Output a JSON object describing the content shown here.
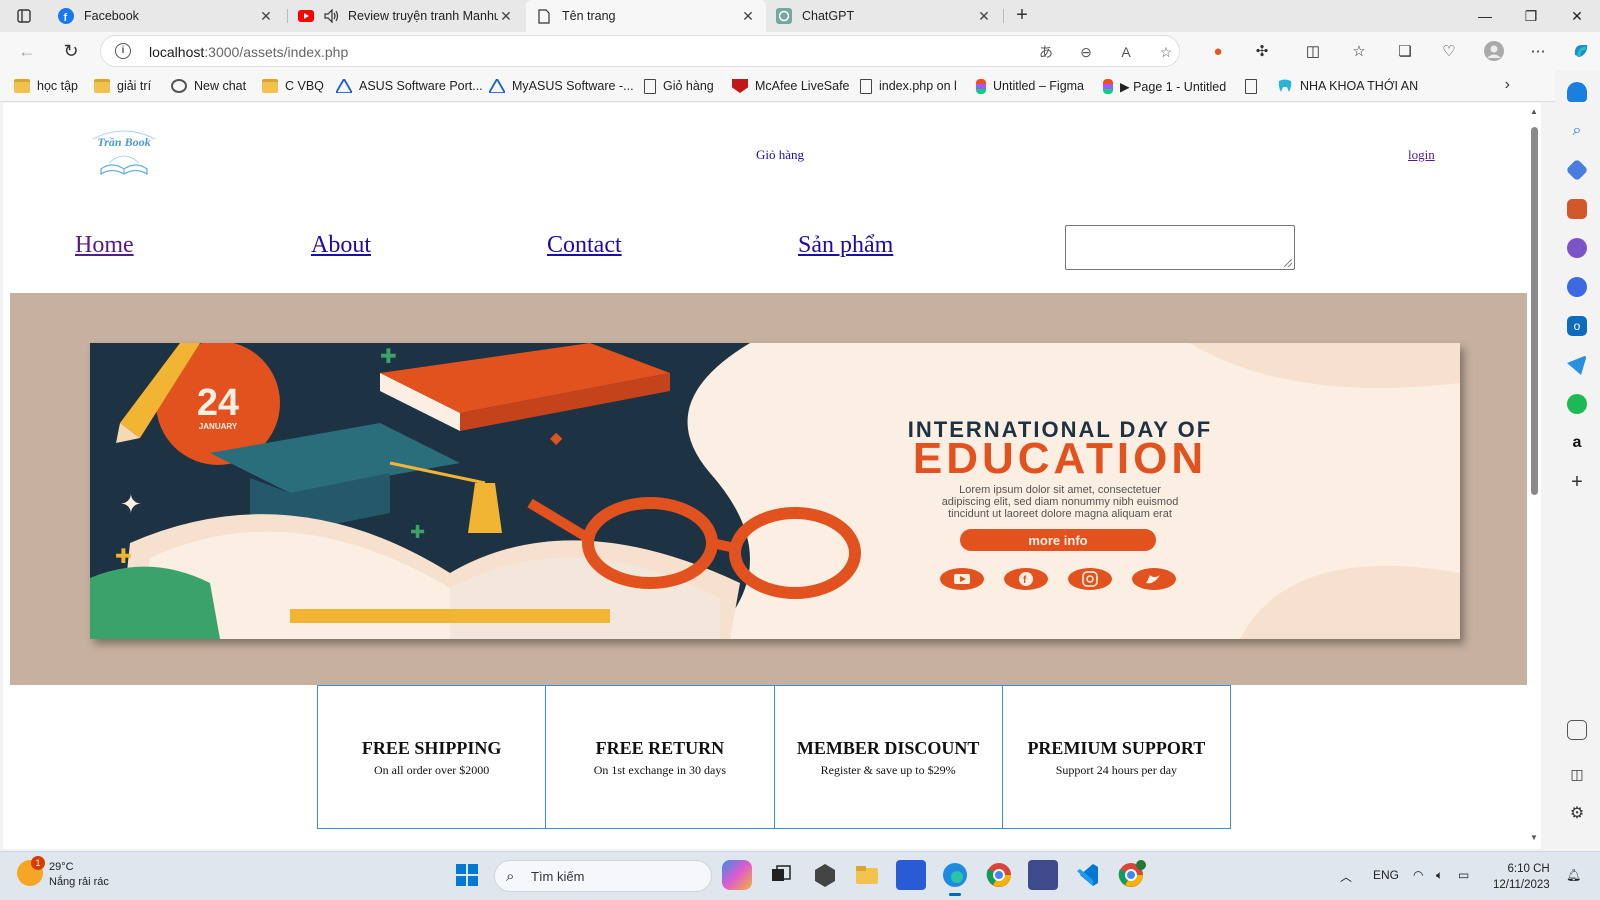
{
  "browser": {
    "tabs": [
      {
        "title": "Facebook",
        "icon": "facebook-icon",
        "active": false
      },
      {
        "title": "Review truyện tranh Manhua",
        "icon": "youtube-icon",
        "active": false
      },
      {
        "title": "Tên trang",
        "icon": "page-icon",
        "active": true
      },
      {
        "title": "ChatGPT",
        "icon": "chatgpt-icon",
        "active": false
      }
    ],
    "url_host": "localhost",
    "url_path": ":3000/assets/index.php",
    "bookmarks": [
      {
        "label": "học tập",
        "icon": "folder-icon"
      },
      {
        "label": "giải trí",
        "icon": "folder-icon"
      },
      {
        "label": "New chat",
        "icon": "chatgpt-icon"
      },
      {
        "label": "C VBQ",
        "icon": "folder-icon"
      },
      {
        "label": "ASUS Software Port...",
        "icon": "asus-icon"
      },
      {
        "label": "MyASUS Software -...",
        "icon": "asus-icon"
      },
      {
        "label": "Giỏ hàng",
        "icon": "page-icon"
      },
      {
        "label": "McAfee LiveSafe",
        "icon": "mcafee-icon"
      },
      {
        "label": "index.php on l",
        "icon": "page-icon"
      },
      {
        "label": "Untitled – Figma",
        "icon": "figma-icon"
      },
      {
        "label": "▶ Page 1 - Untitled",
        "icon": "figma-icon"
      },
      {
        "label": "",
        "icon": "page-icon"
      },
      {
        "label": "NHA KHOA THỚI AN",
        "icon": "tooth-icon"
      }
    ]
  },
  "page": {
    "logo_text": "Trần Book",
    "cart_link": "Giỏ hàng",
    "login_link": "login",
    "nav": [
      {
        "label": "Home",
        "visited": true
      },
      {
        "label": "About",
        "visited": false
      },
      {
        "label": "Contact",
        "visited": false
      },
      {
        "label": "Sản phẩm",
        "visited": false
      }
    ],
    "search_value": "",
    "banner": {
      "heading_line1": "INTERNATIONAL DAY OF",
      "heading_line2": "EDUCATION",
      "date_number": "24",
      "date_month": "JANUARY",
      "body_text": [
        "Lorem ipsum dolor sit amet, consectetuer",
        "adipiscing elit, sed diam nonummy nibh euismod",
        "tincidunt ut laoreet dolore magna aliquam erat"
      ],
      "button": "more info",
      "colors": {
        "orange": "#e1521e",
        "navy": "#1d3243",
        "cream": "#fbeee2",
        "teal": "#2a6e7c"
      }
    },
    "features": [
      {
        "title": "FREE SHIPPING",
        "subtitle": "On all order over $2000"
      },
      {
        "title": "FREE RETURN",
        "subtitle": "On 1st exchange in 30 days"
      },
      {
        "title": "MEMBER DISCOUNT",
        "subtitle": "Register & save up to $29%"
      },
      {
        "title": "PREMIUM SUPPORT",
        "subtitle": "Support 24 hours per day"
      }
    ],
    "hero_bg": "#c6b09f",
    "feature_border": "#3b8fd6"
  },
  "taskbar": {
    "weather_temp": "29°C",
    "weather_desc": "Nắng rải rác",
    "weather_badge": "1",
    "search_placeholder": "Tìm kiếm",
    "language": "ENG",
    "time": "6:10 CH",
    "date": "12/11/2023"
  }
}
